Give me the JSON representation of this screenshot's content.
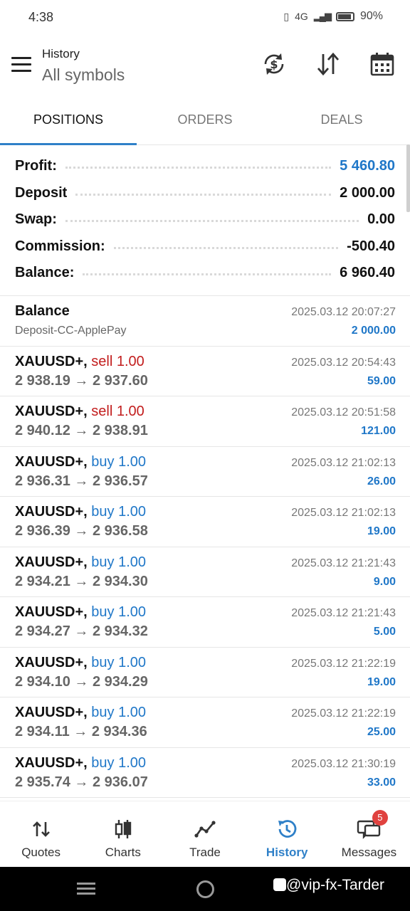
{
  "status_bar": {
    "time": "4:38",
    "network": "4G",
    "battery": "90%"
  },
  "app_bar": {
    "title_small": "History",
    "title_big": "All symbols"
  },
  "tabs": [
    {
      "label": "POSITIONS",
      "active": true
    },
    {
      "label": "ORDERS",
      "active": false
    },
    {
      "label": "DEALS",
      "active": false
    }
  ],
  "summary": {
    "profit_label": "Profit:",
    "profit_value": "5 460.80",
    "deposit_label": "Deposit",
    "deposit_value": "2 000.00",
    "swap_label": "Swap:",
    "swap_value": "0.00",
    "commission_label": "Commission:",
    "commission_value": "-500.40",
    "balance_label": "Balance:",
    "balance_value": "6 960.40"
  },
  "balance_entry": {
    "title": "Balance",
    "subtitle": "Deposit-CC-ApplePay",
    "date": "2025.03.12 20:07:27",
    "amount": "2 000.00"
  },
  "positions": [
    {
      "symbol": "XAUUSD+,",
      "side": "sell",
      "side_text": "sell 1.00",
      "prices": "2 938.19 → 2 937.60",
      "date": "2025.03.12 20:54:43",
      "profit": "59.00"
    },
    {
      "symbol": "XAUUSD+,",
      "side": "sell",
      "side_text": "sell 1.00",
      "prices": "2 940.12 → 2 938.91",
      "date": "2025.03.12 20:51:58",
      "profit": "121.00"
    },
    {
      "symbol": "XAUUSD+,",
      "side": "buy",
      "side_text": "buy 1.00",
      "prices": "2 936.31 → 2 936.57",
      "date": "2025.03.12 21:02:13",
      "profit": "26.00"
    },
    {
      "symbol": "XAUUSD+,",
      "side": "buy",
      "side_text": "buy 1.00",
      "prices": "2 936.39 → 2 936.58",
      "date": "2025.03.12 21:02:13",
      "profit": "19.00"
    },
    {
      "symbol": "XAUUSD+,",
      "side": "buy",
      "side_text": "buy 1.00",
      "prices": "2 934.21 → 2 934.30",
      "date": "2025.03.12 21:21:43",
      "profit": "9.00"
    },
    {
      "symbol": "XAUUSD+,",
      "side": "buy",
      "side_text": "buy 1.00",
      "prices": "2 934.27 → 2 934.32",
      "date": "2025.03.12 21:21:43",
      "profit": "5.00"
    },
    {
      "symbol": "XAUUSD+,",
      "side": "buy",
      "side_text": "buy 1.00",
      "prices": "2 934.10 → 2 934.29",
      "date": "2025.03.12 21:22:19",
      "profit": "19.00"
    },
    {
      "symbol": "XAUUSD+,",
      "side": "buy",
      "side_text": "buy 1.00",
      "prices": "2 934.11 → 2 934.36",
      "date": "2025.03.12 21:22:19",
      "profit": "25.00"
    },
    {
      "symbol": "XAUUSD+,",
      "side": "buy",
      "side_text": "buy 1.00",
      "prices": "2 935.74 → 2 936.07",
      "date": "2025.03.12 21:30:19",
      "profit": "33.00"
    }
  ],
  "bottom_nav": {
    "quotes": "Quotes",
    "charts": "Charts",
    "trade": "Trade",
    "history": "History",
    "messages": "Messages",
    "messages_badge": "5",
    "active": "history"
  },
  "watermark": "@vip-fx-Tarder",
  "colors": {
    "accent": "#2f80c8",
    "profit_blue": "#1f77c8",
    "sell_red": "#c21d1d",
    "badge_red": "#e0423f"
  },
  "icons": {
    "menu": "hamburger-menu-icon",
    "currency_exchange": "dollar-refresh-icon",
    "sort": "sort-arrows-icon",
    "calendar": "calendar-icon"
  }
}
